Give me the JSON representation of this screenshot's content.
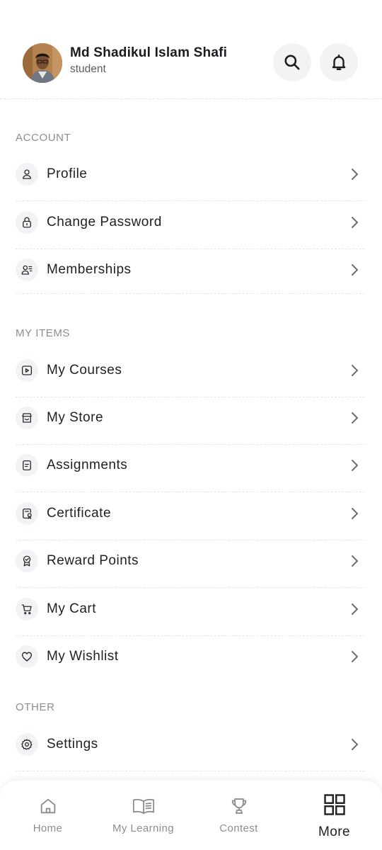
{
  "user": {
    "name": "Md Shadikul Islam Shafi",
    "role": "student"
  },
  "sections": {
    "account": {
      "title": "ACCOUNT",
      "items": [
        {
          "label": "Profile",
          "icon": "user-icon"
        },
        {
          "label": "Change Password",
          "icon": "lock-icon"
        },
        {
          "label": "Memberships",
          "icon": "user-list-icon"
        }
      ]
    },
    "my_items": {
      "title": "MY ITEMS",
      "items": [
        {
          "label": "My Courses",
          "icon": "video-icon"
        },
        {
          "label": "My Store",
          "icon": "store-icon"
        },
        {
          "label": "Assignments",
          "icon": "document-icon"
        },
        {
          "label": "Certificate",
          "icon": "certificate-icon"
        },
        {
          "label": "Reward Points",
          "icon": "award-icon"
        },
        {
          "label": "My Cart",
          "icon": "cart-icon"
        },
        {
          "label": "My Wishlist",
          "icon": "heart-icon"
        }
      ]
    },
    "other": {
      "title": "OTHER",
      "items": [
        {
          "label": "Settings",
          "icon": "gear-icon"
        }
      ]
    }
  },
  "bottom_nav": [
    {
      "label": "Home",
      "icon": "home-icon",
      "active": false
    },
    {
      "label": "My Learning",
      "icon": "book-icon",
      "active": false
    },
    {
      "label": "Contest",
      "icon": "trophy-icon",
      "active": false
    },
    {
      "label": "More",
      "icon": "grid-icon",
      "active": true
    }
  ],
  "colors": {
    "text": "#1f2024",
    "muted": "#8b8d96",
    "icon_bg": "#f2f3f5"
  }
}
